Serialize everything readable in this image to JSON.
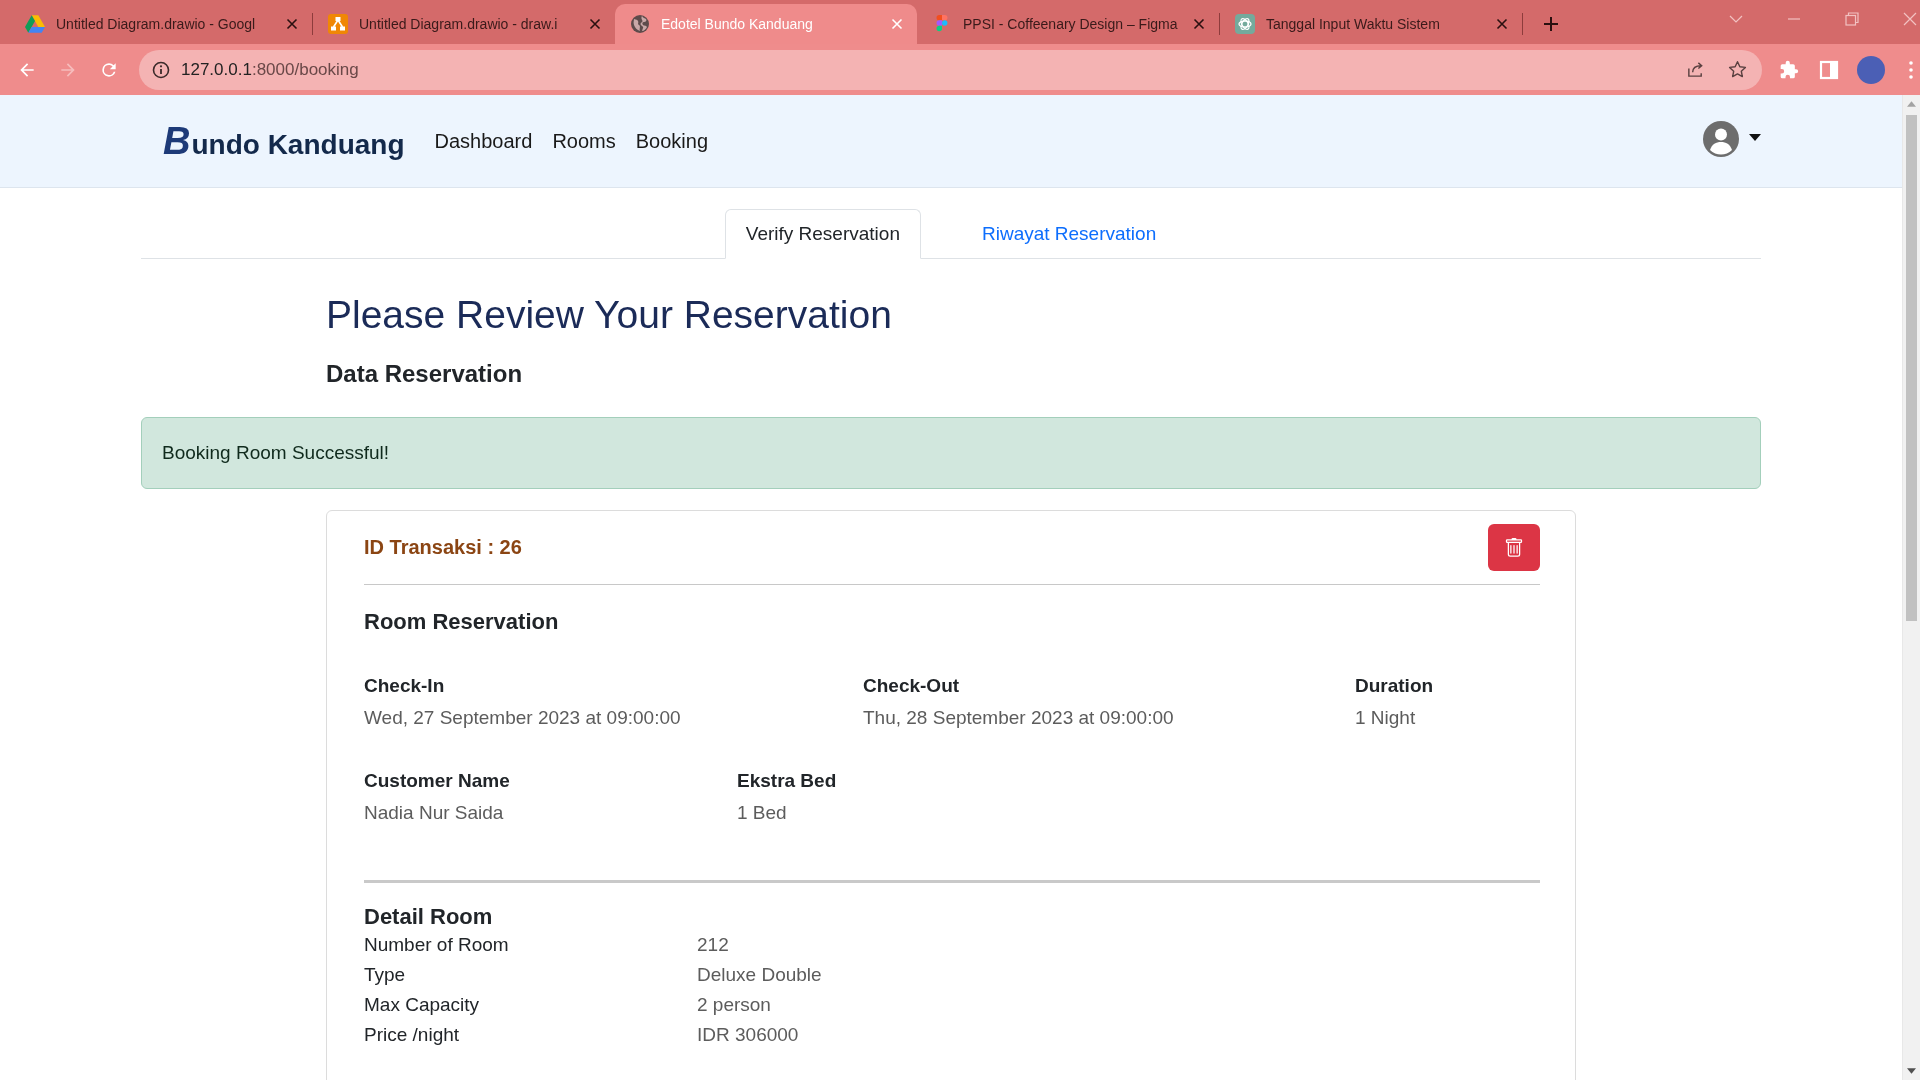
{
  "browser": {
    "tabs": [
      {
        "kind": "drive",
        "title": "Untitled Diagram.drawio - Googl",
        "selected": false
      },
      {
        "kind": "drawio",
        "title": "Untitled Diagram.drawio - draw.i",
        "selected": false
      },
      {
        "kind": "globe",
        "title": "Edotel Bundo Kanduang",
        "selected": true
      },
      {
        "kind": "figma",
        "title": "PPSI - Coffeenary Design – Figma",
        "selected": false
      },
      {
        "kind": "chatgpt",
        "title": "Tanggal Input Waktu Sistem",
        "selected": false
      }
    ],
    "back": {
      "disabled": false
    },
    "forward": {
      "disabled": true
    },
    "address_bar": {
      "host": "127.0.0.1",
      "path": ":8000/booking"
    }
  },
  "navbar": {
    "brand": {
      "initial": "B",
      "name": "undo Kanduang"
    },
    "links": [
      "Dashboard",
      "Rooms",
      "Booking"
    ]
  },
  "tabs": [
    {
      "label": "Verify Reservation",
      "selected": true
    },
    {
      "label": "Riwayat Reservation",
      "selected": false
    }
  ],
  "title": "Please Review Your Reservation",
  "subtitle": "Data Reservation",
  "alert": "Booking Room Successful!",
  "card": {
    "transaction_id": "ID Transaksi : 26",
    "room_reservation": {
      "title": "Room Reservation",
      "rows": [
        [
          {
            "label": "Check-In",
            "value": "Wed, 27 September 2023 at 09:00:00"
          },
          {
            "label": "Check-Out",
            "value": "Thu, 28 September 2023 at 09:00:00"
          },
          {
            "label": "Duration",
            "value": "1 Night"
          }
        ],
        [
          {
            "label": "Customer Name",
            "value": "Nadia Nur Saida"
          },
          {
            "label": "Ekstra Bed",
            "value": "1 Bed"
          }
        ]
      ]
    },
    "detail_room": {
      "title": "Detail Room",
      "rows": [
        {
          "label": "Number of Room",
          "value": "212"
        },
        {
          "label": "Type",
          "value": "Deluxe Double"
        },
        {
          "label": "Max Capacity",
          "value": "2 person"
        },
        {
          "label": "Price /night",
          "value": "IDR 306000"
        }
      ]
    }
  }
}
